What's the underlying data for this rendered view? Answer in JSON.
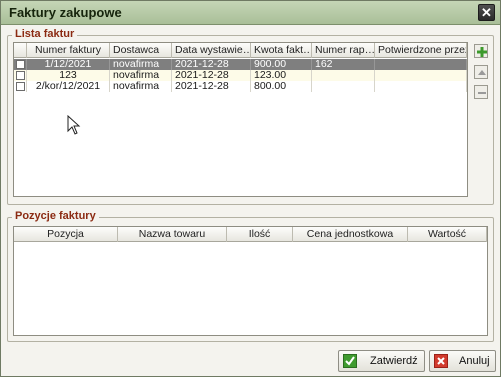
{
  "window": {
    "title": "Faktury zakupowe",
    "close_symbol": "✕"
  },
  "lista": {
    "legend": "Lista faktur",
    "columns": [
      "Numer faktury",
      "Dostawca",
      "Data wystawie…",
      "Kwota fakt…",
      "Numer rap…",
      "Potwierdzone przez …"
    ],
    "rows": [
      {
        "numer": "1/12/2021",
        "dostawca": "novafirma",
        "data": "2021-12-28",
        "kwota": "900.00",
        "raport": "162",
        "potwierdzone": "",
        "selected": true
      },
      {
        "numer": "123",
        "dostawca": "novafirma",
        "data": "2021-12-28",
        "kwota": "123.00",
        "raport": "",
        "potwierdzone": "",
        "selected": false
      },
      {
        "numer": "2/kor/12/2021",
        "dostawca": "novafirma",
        "data": "2021-12-28",
        "kwota": "800.00",
        "raport": "",
        "potwierdzone": "",
        "selected": false
      }
    ]
  },
  "pozycje": {
    "legend": "Pozycje faktury",
    "columns": [
      "Pozycja",
      "Nazwa towaru",
      "Ilość",
      "Cena jednostkowa",
      "Wartość"
    ]
  },
  "buttons": {
    "confirm_label": "Zatwierdź",
    "cancel_label": "Anuluj"
  },
  "colors": {
    "legend": "#8b2a12",
    "selected_row": "#7f7f7f",
    "title_bar": "#b6c9a5"
  },
  "icons": {
    "add": "plus-icon",
    "up": "triangle-up-icon",
    "remove": "minus-icon",
    "confirm": "check-icon",
    "cancel": "x-icon"
  }
}
